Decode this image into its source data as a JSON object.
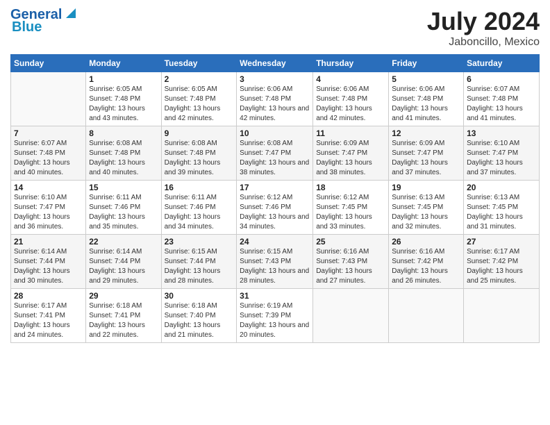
{
  "header": {
    "logo_general": "General",
    "logo_blue": "Blue",
    "month": "July 2024",
    "location": "Jaboncillo, Mexico"
  },
  "weekdays": [
    "Sunday",
    "Monday",
    "Tuesday",
    "Wednesday",
    "Thursday",
    "Friday",
    "Saturday"
  ],
  "weeks": [
    [
      {
        "day": "",
        "sunrise": "",
        "sunset": "",
        "daylight": ""
      },
      {
        "day": "1",
        "sunrise": "Sunrise: 6:05 AM",
        "sunset": "Sunset: 7:48 PM",
        "daylight": "Daylight: 13 hours and 43 minutes."
      },
      {
        "day": "2",
        "sunrise": "Sunrise: 6:05 AM",
        "sunset": "Sunset: 7:48 PM",
        "daylight": "Daylight: 13 hours and 42 minutes."
      },
      {
        "day": "3",
        "sunrise": "Sunrise: 6:06 AM",
        "sunset": "Sunset: 7:48 PM",
        "daylight": "Daylight: 13 hours and 42 minutes."
      },
      {
        "day": "4",
        "sunrise": "Sunrise: 6:06 AM",
        "sunset": "Sunset: 7:48 PM",
        "daylight": "Daylight: 13 hours and 42 minutes."
      },
      {
        "day": "5",
        "sunrise": "Sunrise: 6:06 AM",
        "sunset": "Sunset: 7:48 PM",
        "daylight": "Daylight: 13 hours and 41 minutes."
      },
      {
        "day": "6",
        "sunrise": "Sunrise: 6:07 AM",
        "sunset": "Sunset: 7:48 PM",
        "daylight": "Daylight: 13 hours and 41 minutes."
      }
    ],
    [
      {
        "day": "7",
        "sunrise": "Sunrise: 6:07 AM",
        "sunset": "Sunset: 7:48 PM",
        "daylight": "Daylight: 13 hours and 40 minutes."
      },
      {
        "day": "8",
        "sunrise": "Sunrise: 6:08 AM",
        "sunset": "Sunset: 7:48 PM",
        "daylight": "Daylight: 13 hours and 40 minutes."
      },
      {
        "day": "9",
        "sunrise": "Sunrise: 6:08 AM",
        "sunset": "Sunset: 7:48 PM",
        "daylight": "Daylight: 13 hours and 39 minutes."
      },
      {
        "day": "10",
        "sunrise": "Sunrise: 6:08 AM",
        "sunset": "Sunset: 7:47 PM",
        "daylight": "Daylight: 13 hours and 38 minutes."
      },
      {
        "day": "11",
        "sunrise": "Sunrise: 6:09 AM",
        "sunset": "Sunset: 7:47 PM",
        "daylight": "Daylight: 13 hours and 38 minutes."
      },
      {
        "day": "12",
        "sunrise": "Sunrise: 6:09 AM",
        "sunset": "Sunset: 7:47 PM",
        "daylight": "Daylight: 13 hours and 37 minutes."
      },
      {
        "day": "13",
        "sunrise": "Sunrise: 6:10 AM",
        "sunset": "Sunset: 7:47 PM",
        "daylight": "Daylight: 13 hours and 37 minutes."
      }
    ],
    [
      {
        "day": "14",
        "sunrise": "Sunrise: 6:10 AM",
        "sunset": "Sunset: 7:47 PM",
        "daylight": "Daylight: 13 hours and 36 minutes."
      },
      {
        "day": "15",
        "sunrise": "Sunrise: 6:11 AM",
        "sunset": "Sunset: 7:46 PM",
        "daylight": "Daylight: 13 hours and 35 minutes."
      },
      {
        "day": "16",
        "sunrise": "Sunrise: 6:11 AM",
        "sunset": "Sunset: 7:46 PM",
        "daylight": "Daylight: 13 hours and 34 minutes."
      },
      {
        "day": "17",
        "sunrise": "Sunrise: 6:12 AM",
        "sunset": "Sunset: 7:46 PM",
        "daylight": "Daylight: 13 hours and 34 minutes."
      },
      {
        "day": "18",
        "sunrise": "Sunrise: 6:12 AM",
        "sunset": "Sunset: 7:45 PM",
        "daylight": "Daylight: 13 hours and 33 minutes."
      },
      {
        "day": "19",
        "sunrise": "Sunrise: 6:13 AM",
        "sunset": "Sunset: 7:45 PM",
        "daylight": "Daylight: 13 hours and 32 minutes."
      },
      {
        "day": "20",
        "sunrise": "Sunrise: 6:13 AM",
        "sunset": "Sunset: 7:45 PM",
        "daylight": "Daylight: 13 hours and 31 minutes."
      }
    ],
    [
      {
        "day": "21",
        "sunrise": "Sunrise: 6:14 AM",
        "sunset": "Sunset: 7:44 PM",
        "daylight": "Daylight: 13 hours and 30 minutes."
      },
      {
        "day": "22",
        "sunrise": "Sunrise: 6:14 AM",
        "sunset": "Sunset: 7:44 PM",
        "daylight": "Daylight: 13 hours and 29 minutes."
      },
      {
        "day": "23",
        "sunrise": "Sunrise: 6:15 AM",
        "sunset": "Sunset: 7:44 PM",
        "daylight": "Daylight: 13 hours and 28 minutes."
      },
      {
        "day": "24",
        "sunrise": "Sunrise: 6:15 AM",
        "sunset": "Sunset: 7:43 PM",
        "daylight": "Daylight: 13 hours and 28 minutes."
      },
      {
        "day": "25",
        "sunrise": "Sunrise: 6:16 AM",
        "sunset": "Sunset: 7:43 PM",
        "daylight": "Daylight: 13 hours and 27 minutes."
      },
      {
        "day": "26",
        "sunrise": "Sunrise: 6:16 AM",
        "sunset": "Sunset: 7:42 PM",
        "daylight": "Daylight: 13 hours and 26 minutes."
      },
      {
        "day": "27",
        "sunrise": "Sunrise: 6:17 AM",
        "sunset": "Sunset: 7:42 PM",
        "daylight": "Daylight: 13 hours and 25 minutes."
      }
    ],
    [
      {
        "day": "28",
        "sunrise": "Sunrise: 6:17 AM",
        "sunset": "Sunset: 7:41 PM",
        "daylight": "Daylight: 13 hours and 24 minutes."
      },
      {
        "day": "29",
        "sunrise": "Sunrise: 6:18 AM",
        "sunset": "Sunset: 7:41 PM",
        "daylight": "Daylight: 13 hours and 22 minutes."
      },
      {
        "day": "30",
        "sunrise": "Sunrise: 6:18 AM",
        "sunset": "Sunset: 7:40 PM",
        "daylight": "Daylight: 13 hours and 21 minutes."
      },
      {
        "day": "31",
        "sunrise": "Sunrise: 6:19 AM",
        "sunset": "Sunset: 7:39 PM",
        "daylight": "Daylight: 13 hours and 20 minutes."
      },
      {
        "day": "",
        "sunrise": "",
        "sunset": "",
        "daylight": ""
      },
      {
        "day": "",
        "sunrise": "",
        "sunset": "",
        "daylight": ""
      },
      {
        "day": "",
        "sunrise": "",
        "sunset": "",
        "daylight": ""
      }
    ]
  ]
}
